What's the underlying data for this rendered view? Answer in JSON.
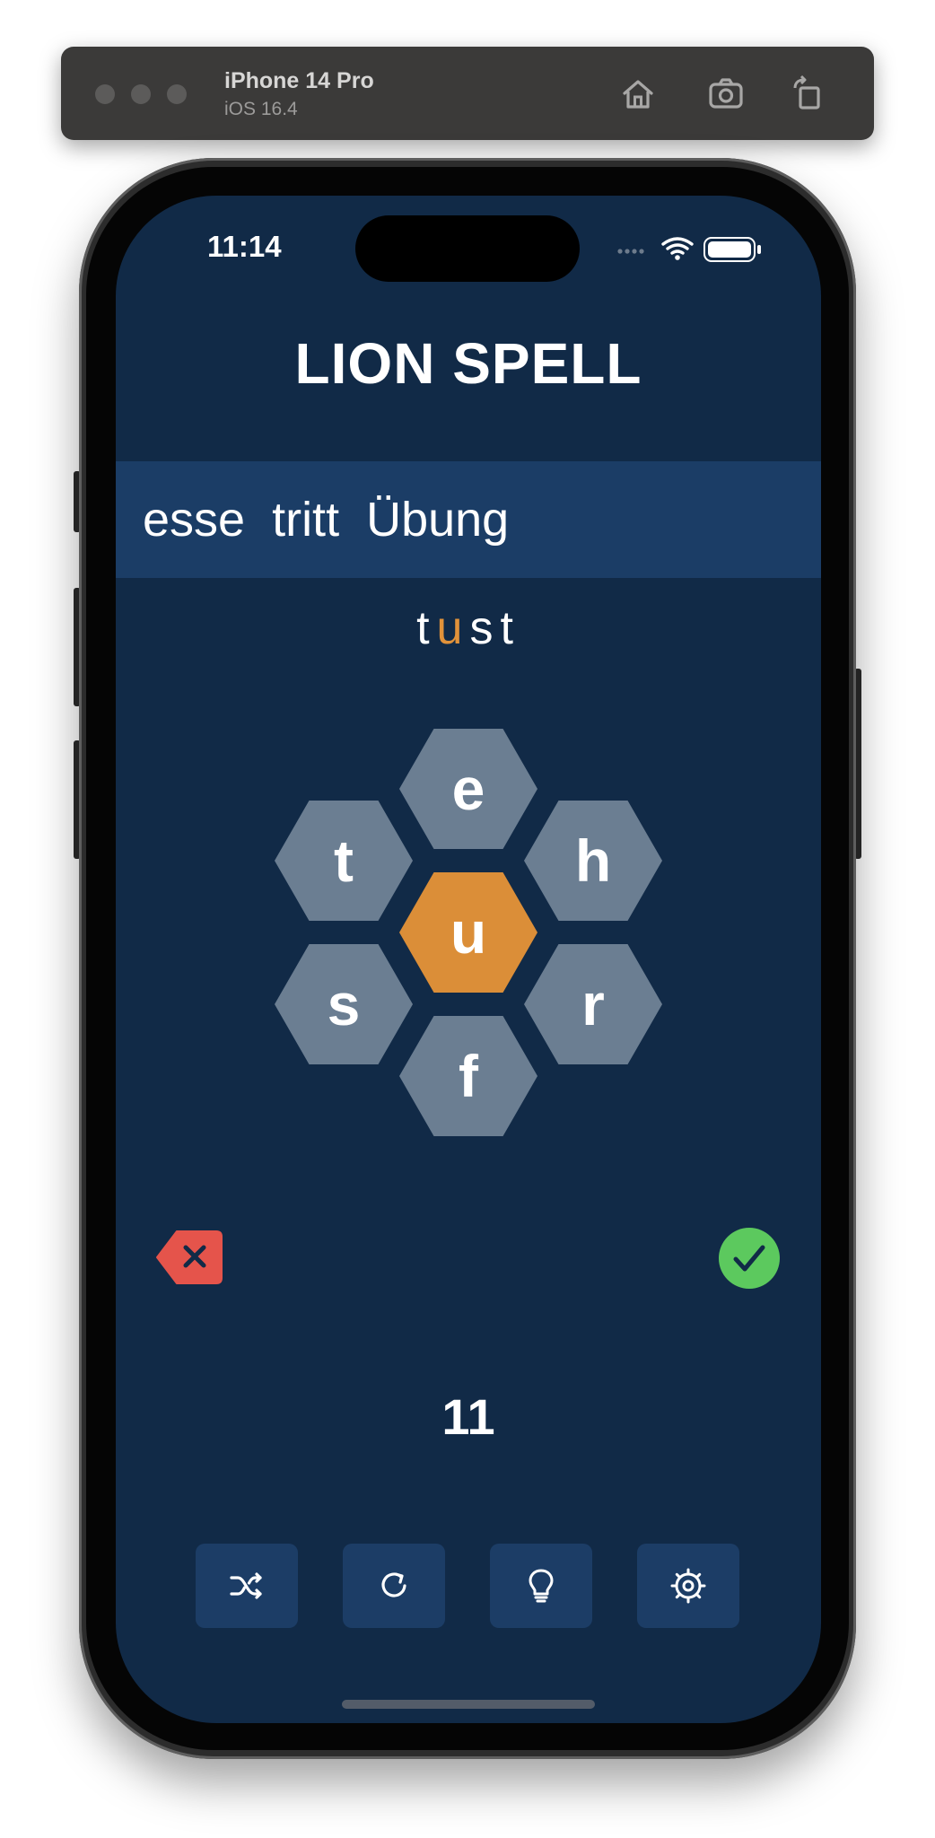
{
  "simulator": {
    "device_name": "iPhone 14 Pro",
    "os_version": "iOS 16.4",
    "icons": [
      "home-icon",
      "screenshot-icon",
      "rotate-icon"
    ]
  },
  "status_bar": {
    "time": "11:14",
    "icons": [
      "cellular-icon",
      "wifi-icon",
      "battery-icon"
    ]
  },
  "app": {
    "title": "LION SPELL",
    "found_words": [
      "esse",
      "tritt",
      "Übung"
    ],
    "current_word": {
      "letters": [
        "t",
        "u",
        "s",
        "t"
      ],
      "highlight_letter": "u"
    },
    "hive": {
      "center": "u",
      "top": "e",
      "upper_left": "t",
      "upper_right": "h",
      "lower_left": "s",
      "lower_right": "r",
      "bottom": "f"
    },
    "score": "11",
    "actions": {
      "delete_icon": "delete-icon",
      "submit_icon": "checkmark-icon"
    },
    "toolbar": [
      "shuffle-icon",
      "restart-icon",
      "lightbulb-icon",
      "settings-icon"
    ]
  },
  "colors": {
    "background": "#112a47",
    "found_band": "#1b3d66",
    "hex_outer": "#6b7e92",
    "hex_center": "#db8e38",
    "highlight": "#e1923a",
    "delete": "#e5544b",
    "submit": "#5cc95e",
    "toolbar_button": "#1c3d66"
  }
}
